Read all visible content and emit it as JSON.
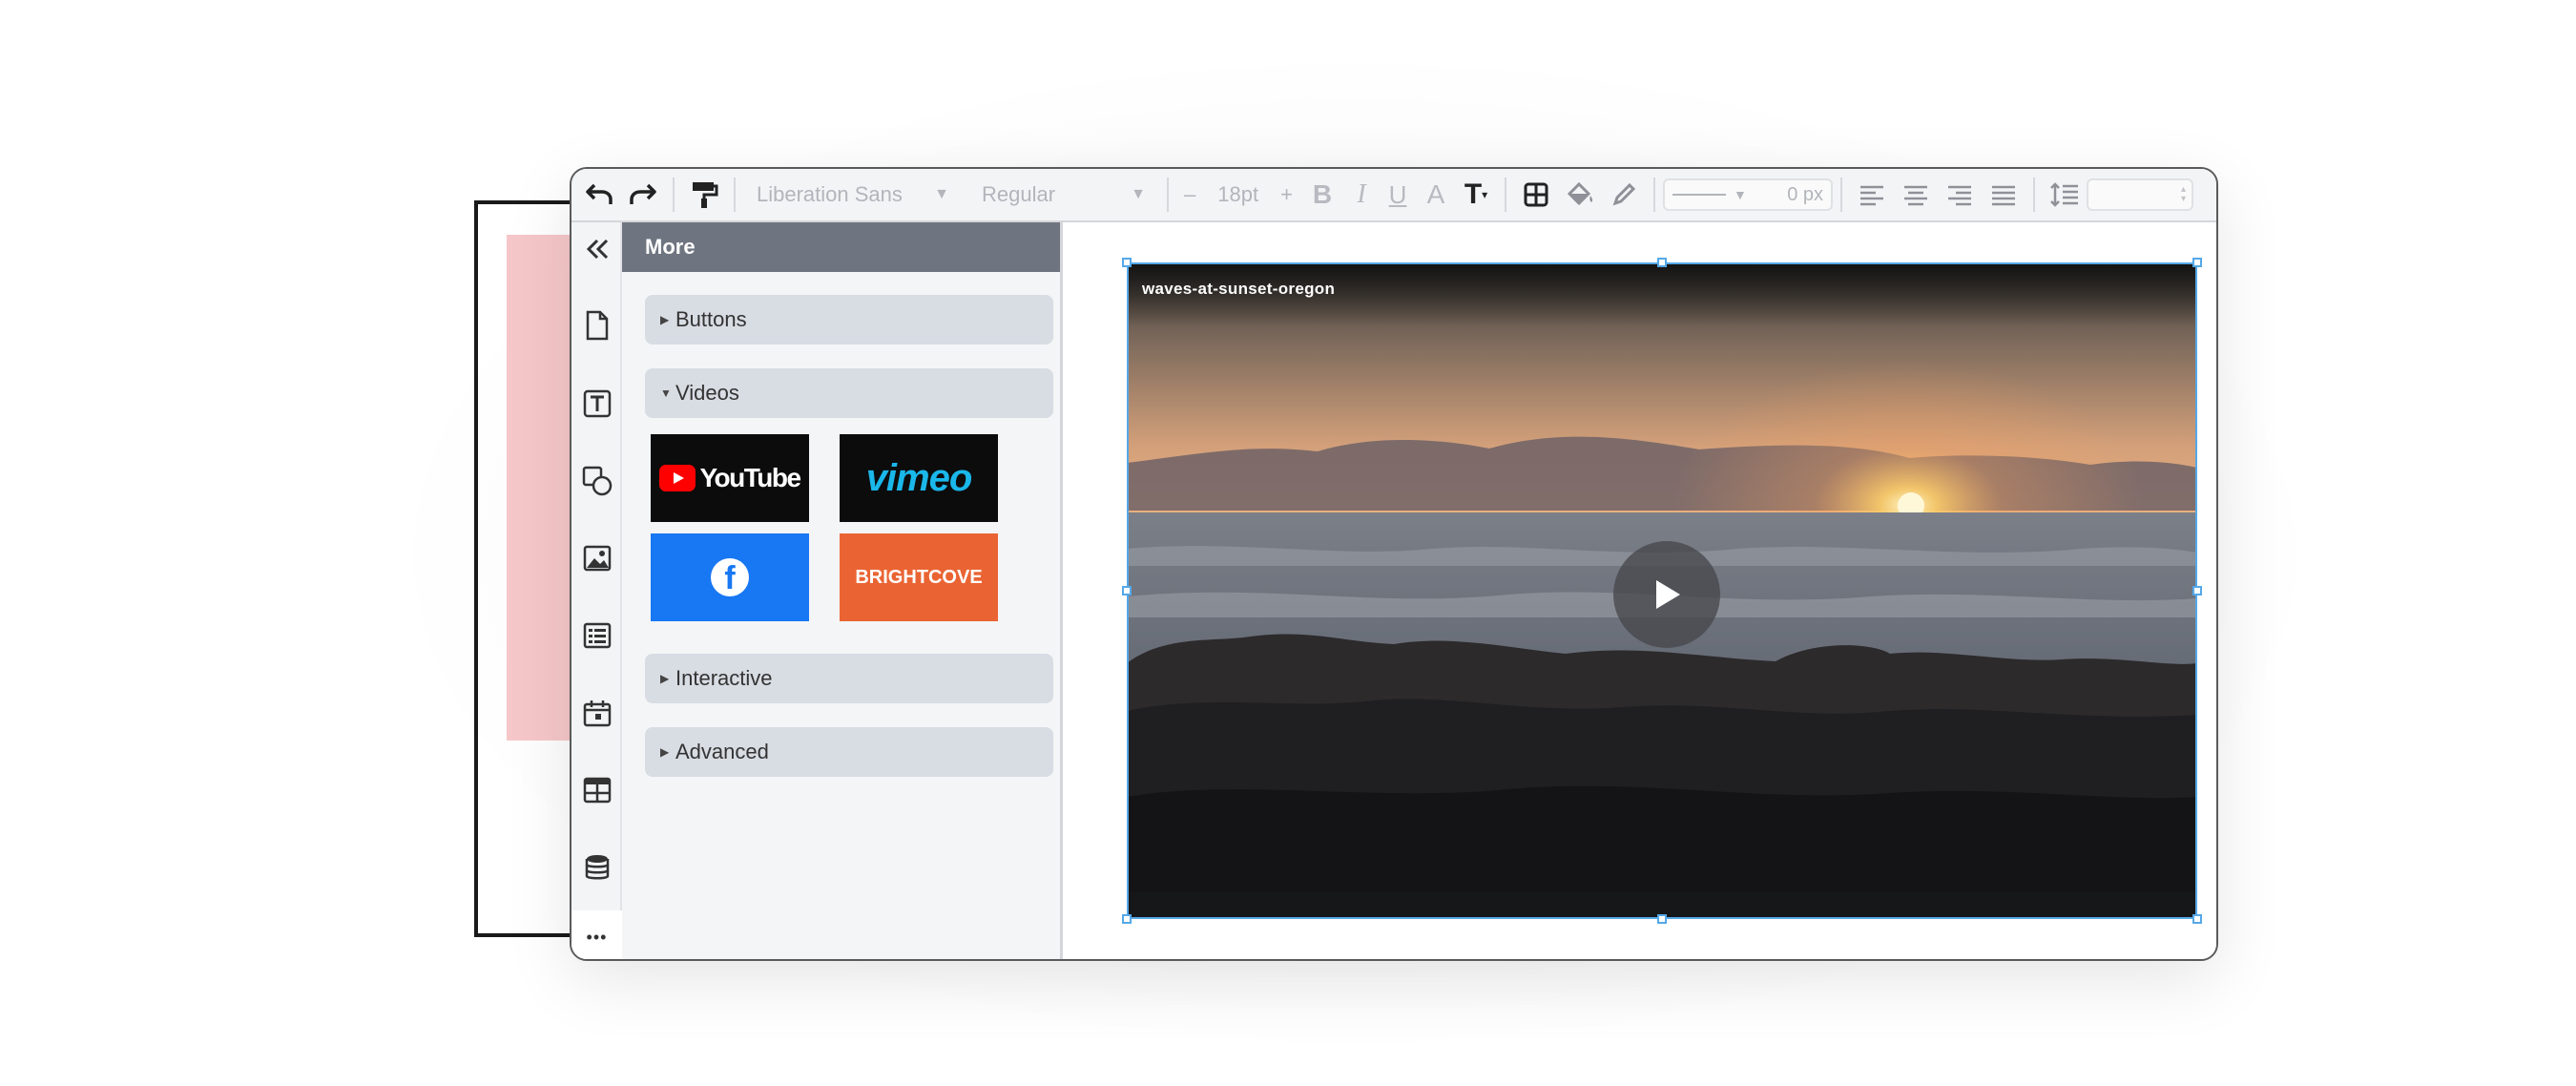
{
  "toolbar": {
    "font_family": "Liberation Sans",
    "font_style": "Regular",
    "font_size": "18pt",
    "minus": "–",
    "plus": "+",
    "bold": "B",
    "italic": "I",
    "underline": "U",
    "text_a": "A",
    "text_t": "T",
    "border_width": "0 px"
  },
  "rail": {
    "more_label": "•••"
  },
  "panel": {
    "header": "More",
    "sections": {
      "buttons": "Buttons",
      "videos": "Videos",
      "interactive": "Interactive",
      "advanced": "Advanced"
    },
    "tiles": {
      "youtube": "YouTube",
      "vimeo": "vimeo",
      "facebook": "f",
      "brightcove": "BRIGHTCOVE"
    }
  },
  "canvas": {
    "video_title": "waves-at-sunset-oregon"
  },
  "colors": {
    "selection": "#55a8e8",
    "panel_header": "#6f7580",
    "facebook_tile": "#1877f2",
    "brightcove_tile": "#ea6433",
    "youtube_red": "#ff0000",
    "vimeo_blue": "#1ab7ea"
  }
}
